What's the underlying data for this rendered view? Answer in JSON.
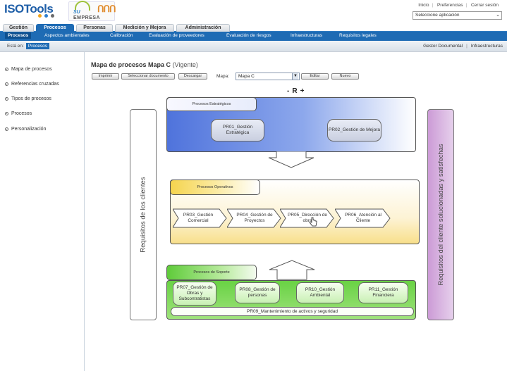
{
  "header": {
    "logo_text": "ISOTools",
    "logo_dot_colors": [
      "#f2a51c",
      "#2e7fcf",
      "#6b6b6b"
    ],
    "brand_line1": "SU",
    "brand_line2": "EMPRESA",
    "links": [
      "Inicio",
      "Preferencias",
      "Cerrar sesión"
    ],
    "app_select": "Seleccione aplicación"
  },
  "tabs": [
    {
      "label": "Gestión",
      "active": false
    },
    {
      "label": "Procesos",
      "active": true
    },
    {
      "label": "Personas",
      "active": false
    },
    {
      "label": "Medición y Mejora",
      "active": false
    },
    {
      "label": "Administración",
      "active": false
    }
  ],
  "subnav": [
    {
      "label": "Procesos",
      "active": true
    },
    {
      "label": "Aspectos ambientales",
      "active": false
    },
    {
      "label": "Calibración",
      "active": false
    },
    {
      "label": "Evaluación de proveedores",
      "active": false
    },
    {
      "label": "Evaluación de riesgos",
      "active": false
    },
    {
      "label": "Infraestructuras",
      "active": false
    },
    {
      "label": "Requisitos legales",
      "active": false
    }
  ],
  "breadcrumb": {
    "prefix": "Está en:",
    "current": "Procesos",
    "right_links": [
      "Gestor Documental",
      "Infraestructuras"
    ]
  },
  "sidebar": [
    "Mapa de procesos",
    "Referencias cruzadas",
    "Tipos de procesos",
    "Procesos",
    "Personalización"
  ],
  "content": {
    "title": "Mapa de procesos Mapa C",
    "status": "(Vigente)",
    "buttons": [
      "Imprimir",
      "Seleccionar documento",
      "Descargar"
    ],
    "map_label": "Mapa:",
    "map_value": "Mapa C",
    "edit_button": "Editar",
    "new_button": "Nuevo",
    "zoom_minus": "-",
    "zoom_reset": "R",
    "zoom_plus": "+"
  },
  "diagram": {
    "left_text": "Requisitos de los clientes",
    "right_text": "Requisitos del cliente solucionadas y satisfechas",
    "left_color": "#ffffff",
    "right_color": "#d9b6df",
    "strategic": {
      "label": "Procesos Estratégicos",
      "nodes": [
        "PR01_Gestión Estratégica",
        "PR02_Gestión de Mejora"
      ]
    },
    "operative": {
      "label": "Procesos Operativos",
      "nodes": [
        "PR03_Gestión Comercial",
        "PR04_Gestión de Proyectos",
        "PR05_Dirección de obra",
        "PR06_Atención al Cliente"
      ]
    },
    "support": {
      "label": "Procesos de Soporte",
      "nodes": [
        "PR07_Gestión de Obras y Subcontratistas",
        "PR08_Gestión de personas",
        "PR10_Gestión Ambiental",
        "PR11_Gestión Financiera"
      ],
      "bottom": "PR09_Mantenimiento de activos y seguridad"
    }
  }
}
